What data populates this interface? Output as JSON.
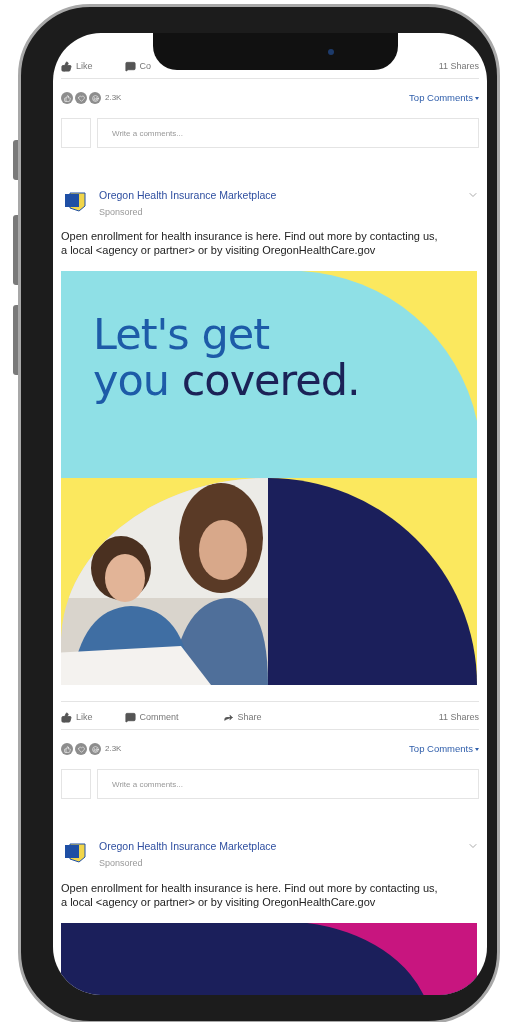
{
  "feed": [
    {
      "kind": "engagement",
      "actions": [
        {
          "kind": "like",
          "label": "Like"
        },
        {
          "kind": "comment",
          "label": "Co"
        }
      ],
      "shares": "11 Shares",
      "reaction_count": "2.3K",
      "sort_label": "Top Comments",
      "comment_placeholder": "Write a comments..."
    },
    {
      "kind": "post",
      "page": "Oregon Health Insurance Marketplace",
      "sponsored": "Sponsored",
      "text": "Open enrollment for health insurance is here. Find out more by contacting us, a local <agency or partner> or by visiting OregonHealthCare.gov",
      "ad": {
        "kind": "covered",
        "headline": [
          "Let's get",
          "you",
          "covered."
        ]
      }
    },
    {
      "kind": "engagement",
      "actions": [
        {
          "kind": "like",
          "label": "Like"
        },
        {
          "kind": "comment",
          "label": "Comment"
        },
        {
          "kind": "share",
          "label": "Share"
        }
      ],
      "shares": "11 Shares",
      "reaction_count": "2.3K",
      "sort_label": "Top Comments",
      "comment_placeholder": "Write a comments..."
    },
    {
      "kind": "post",
      "page": "Oregon Health Insurance Marketplace",
      "sponsored": "Sponsored",
      "text": "Open enrollment for health insurance is here. Find out more by contacting us, a local <agency or partner> or by visiting OregonHealthCare.gov",
      "ad": {
        "kind": "dark"
      }
    }
  ]
}
